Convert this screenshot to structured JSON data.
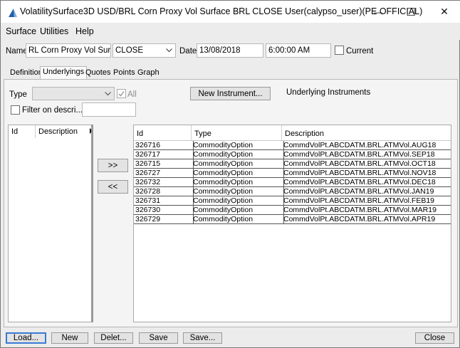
{
  "window": {
    "title": "VolatilitySurface3D USD/BRL Corn Proxy Vol Surface BRL CLOSE User(calypso_user)(PE OFFICIAL)",
    "minimize_icon": "—",
    "maximize_icon": "☐",
    "close_icon": "✕"
  },
  "menu": [
    "Surface",
    "Utilities",
    "Help"
  ],
  "toolbar": {
    "name_label": "Name",
    "name_value": "RL Corn Proxy Vol Surface",
    "type_value": "CLOSE",
    "date_label": "Date",
    "date_value": "13/08/2018",
    "time_value": "6:00:00 AM",
    "current_label": "Current"
  },
  "tabs": [
    "Definition",
    "Underlyings",
    "Quotes",
    "Points",
    "Graph"
  ],
  "active_tab": "Underlyings",
  "underlyings": {
    "type_label": "Type",
    "all_label": "All",
    "filter_label": "Filter on descri...",
    "new_instrument_label": "New Instrument...",
    "underlying_instruments_label": "Underlying Instruments",
    "left_columns": [
      "Id",
      "Description"
    ],
    "move_right_label": ">>",
    "move_left_label": "<<",
    "right_columns": [
      "Id",
      "Type",
      "Description"
    ],
    "rows": [
      {
        "id": "326716",
        "type": "CommodityOption",
        "description": "CommdVolPt.ABCDATM.BRL.ATMVol.AUG18"
      },
      {
        "id": "326717",
        "type": "CommodityOption",
        "description": "CommdVolPt.ABCDATM.BRL.ATMVol.SEP18"
      },
      {
        "id": "326715",
        "type": "CommodityOption",
        "description": "CommdVolPt.ABCDATM.BRL.ATMVol.OCT18"
      },
      {
        "id": "326727",
        "type": "CommodityOption",
        "description": "CommdVolPt.ABCDATM.BRL.ATMVol.NOV18"
      },
      {
        "id": "326732",
        "type": "CommodityOption",
        "description": "CommdVolPt.ABCDATM.BRL.ATMVol.DEC18"
      },
      {
        "id": "326728",
        "type": "CommodityOption",
        "description": "CommdVolPt.ABCDATM.BRL.ATMVol.JAN19"
      },
      {
        "id": "326731",
        "type": "CommodityOption",
        "description": "CommdVolPt.ABCDATM.BRL.ATMVol.FEB19"
      },
      {
        "id": "326730",
        "type": "CommodityOption",
        "description": "CommdVolPt.ABCDATM.BRL.ATMVol.MAR19"
      },
      {
        "id": "326729",
        "type": "CommodityOption",
        "description": "CommdVolPt.ABCDATM.BRL.ATMVol.APR19"
      }
    ]
  },
  "bottom_buttons": {
    "load": "Load...",
    "new": "New",
    "delete": "Delet...",
    "save": "Save",
    "save_as": "Save...",
    "close": "Close"
  }
}
